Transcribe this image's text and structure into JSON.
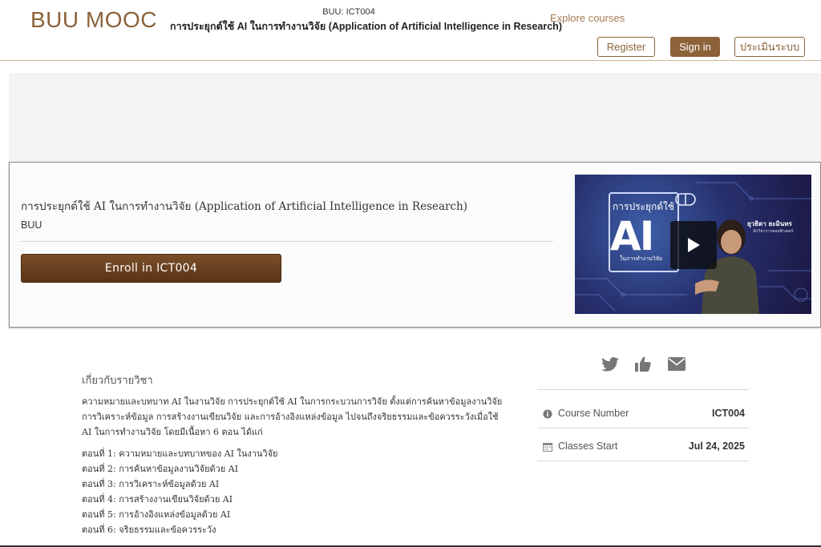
{
  "header": {
    "logo": "BUU MOOC",
    "course_code": "BUU: ICT004",
    "course_title": "การประยุกต์ใช้ AI ในการทำงานวิจัย (Application of Artificial Intelligence in Research)",
    "explore_label": "Explore courses",
    "register_label": "Register",
    "signin_label": "Sign in",
    "eval_label": "ประเมินระบบ"
  },
  "hero": {
    "title": "การประยุกต์ใช้ AI ในการทำงานวิจัย (Application of Artificial Intelligence in Research)",
    "org": "BUU",
    "enroll_label": "Enroll in ICT004",
    "video": {
      "line1": "การประยุกต์ใช้",
      "ai": "AI",
      "line2": "ในการทำงานวิจัย",
      "presenter": "ยุวธิดา ยะมินทร",
      "presenter_role": "นักวิชาการคอมพิวเตอร์"
    }
  },
  "about": {
    "heading": "เกี่ยวกับรายวิชา",
    "description": "ความหมายและบทบาท AI ในงานวิจัย การประยุกต์ใช้ AI ในการกระบวนการวิจัย ตั้งแต่การค้นหาข้อมูลงานวิจัย การวิเคราะห์ข้อมูล การสร้างงานเขียนวิจัย และการอ้างอิงแหล่งข้อมูล ไปจนถึงจริยธรรมและข้อควรระวังเมื่อใช้ AI ในการทำงานวิจัย โดยมีเนื้อหา 6 ตอน ได้แก่",
    "lessons": [
      "ตอนที่ 1: ความหมายและบทบาทของ AI ในงานวิจัย",
      "ตอนที่ 2: การค้นหาข้อมูลงานวิจัยด้วย AI",
      "ตอนที่ 3: การวิเคราะห์ข้อมูลด้วย AI",
      "ตอนที่ 4: การสร้างงานเขียนวิจัยด้วย AI",
      "ตอนที่ 5: การอ้างอิงแหล่งข้อมูลด้วย AI",
      "ตอนที่ 6: จริยธรรมและข้อควรระวัง"
    ]
  },
  "sidebar": {
    "icons": [
      "twitter-icon",
      "thumbs-up-icon",
      "envelope-icon"
    ],
    "course_number_label": "Course Number",
    "course_number_value": "ICT004",
    "classes_start_label": "Classes Start",
    "classes_start_value": "Jul 24, 2025"
  },
  "colors": {
    "brand_brown": "#8c6239",
    "enroll_brown": "#5a3416",
    "link_tan": "#a67c52"
  }
}
